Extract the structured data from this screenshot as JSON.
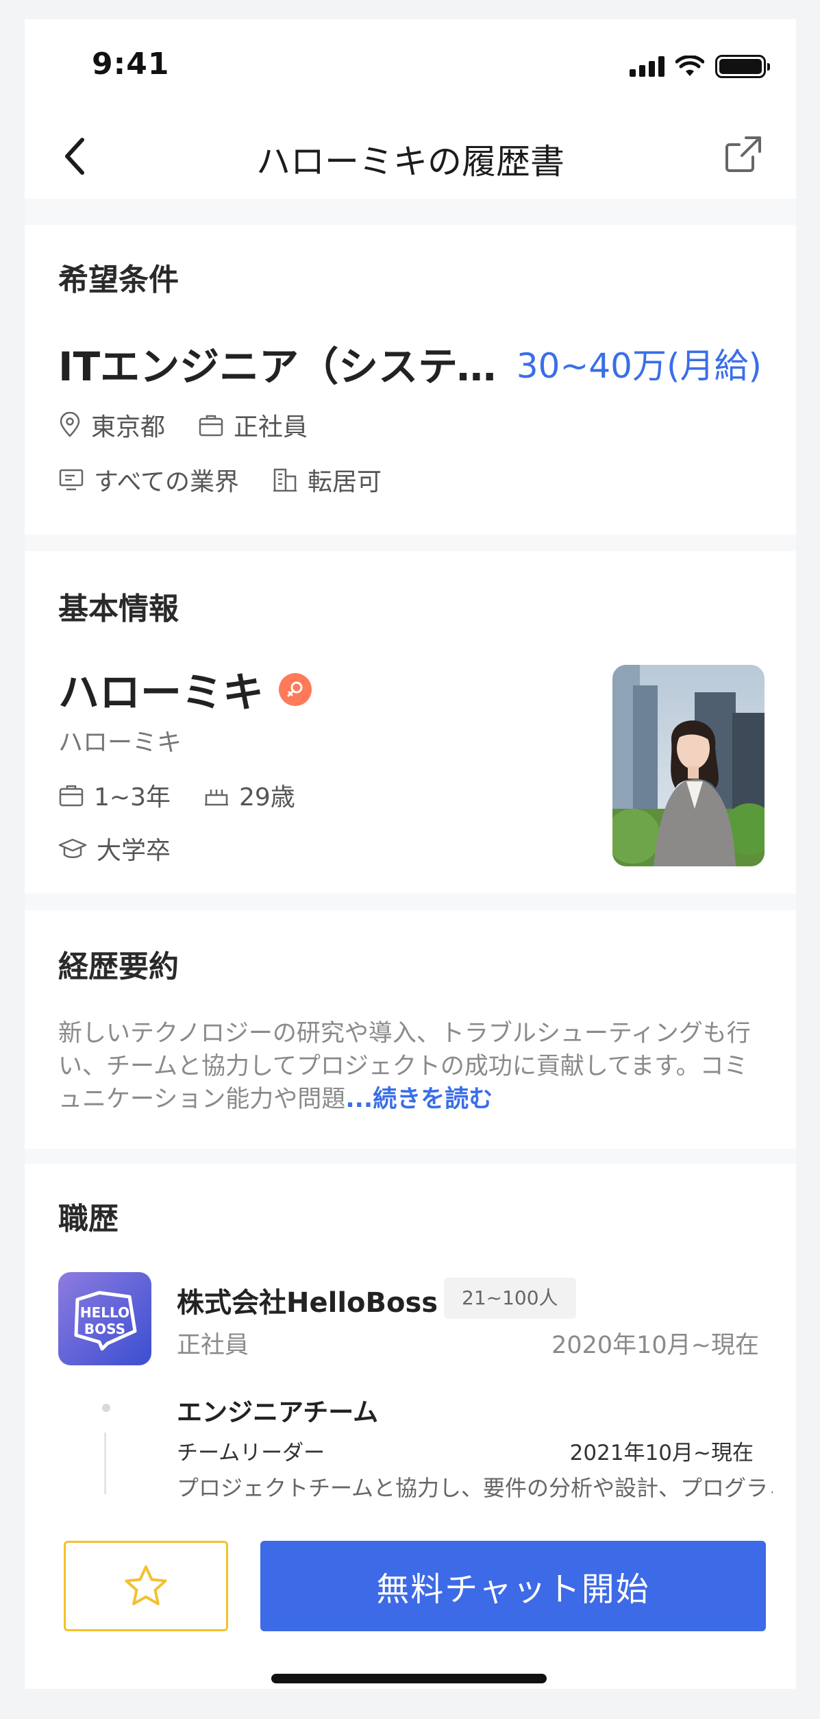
{
  "status_bar": {
    "time": "9:41"
  },
  "nav": {
    "title": "ハローミキの履歴書"
  },
  "desired": {
    "section_title": "希望条件",
    "job_title": "ITエンジニア（システムエンジニア）",
    "salary": "30~40万(月給)",
    "location": "東京都",
    "employment_type": "正社員",
    "industry": "すべての業界",
    "relocation": "転居可"
  },
  "basic": {
    "section_title": "基本情報",
    "name": "ハローミキ",
    "name_reading": "ハローミキ",
    "experience": "1~3年",
    "age": "29歳",
    "education": "大学卒"
  },
  "summary": {
    "section_title": "経歴要約",
    "text": "新しいテクノロジーの研究や導入、トラブルシューティングも行い、チームと協力してプロジェクトの成功に貢献してます。コミュニケーション能力や問題",
    "read_more": "...続きを読む"
  },
  "career": {
    "section_title": "職歴",
    "company": {
      "logo_text_1": "HELLO",
      "logo_text_2": "BOSS",
      "name": "株式会社HelloBoss",
      "size": "21~100人",
      "employment_type": "正社員",
      "period": "2020年10月~現在"
    },
    "team": {
      "name": "エンジニアチーム",
      "role": "チームリーダー",
      "period": "2021年10月~現在",
      "description": "プロジェクトチームと協力し、要件の分析や設計、プログラミ"
    }
  },
  "actions": {
    "chat_label": "無料チャット開始"
  },
  "colors": {
    "accent": "#3d6ae6",
    "salary": "#3a6ee8",
    "favorite_border": "#f2c12e",
    "gender_badge": "#ff7a59"
  }
}
